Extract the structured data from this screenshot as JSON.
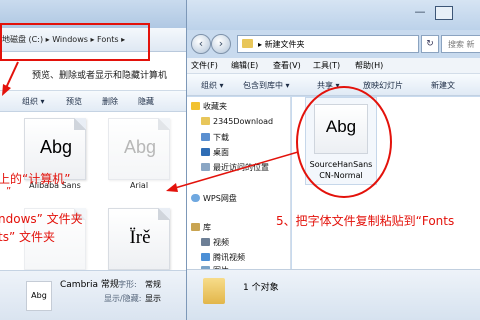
{
  "left_window": {
    "breadcrumb": [
      "地磁盘 (C:)",
      "Windows",
      "Fonts"
    ],
    "description": "预览、删除或者显示和隐藏计算机",
    "toolbar": [
      "组织 ▾",
      "预览",
      "删除",
      "隐藏"
    ],
    "fonts": [
      {
        "glyph": "Abg",
        "name": "Alibaba Sans"
      },
      {
        "glyph": "Abg",
        "name": "Arial"
      },
      {
        "glyph": "",
        "name": ""
      },
      {
        "glyph": "Ïrě",
        "name": ""
      }
    ],
    "status": {
      "glyph": "Abg",
      "name": "Cambria 常规",
      "label_style": "字形:",
      "style_value": "常规",
      "label_show": "显示/隐藏:",
      "show_value": "显示"
    }
  },
  "right_window": {
    "address": [
      "新建文件夹"
    ],
    "search_placeholder": "搜索 新",
    "menu": [
      "文件(F)",
      "编辑(E)",
      "查看(V)",
      "工具(T)",
      "帮助(H)"
    ],
    "toolbar": [
      "组织 ▾",
      "包含到库中 ▾",
      "共享 ▾",
      "放映幻灯片",
      "新建文"
    ],
    "nav": {
      "favorites_label": "收藏夹",
      "favorites": [
        "2345Download",
        "下载",
        "桌面",
        "最近访问的位置"
      ],
      "wps_label": "WPS网盘",
      "library_label": "库",
      "libraries": [
        "视频",
        "腾讯视频",
        "图片"
      ]
    },
    "file": {
      "glyph": "Abg",
      "name_line1": "SourceHanSans",
      "name_line2": "CN-Normal"
    },
    "status": "1 个对象"
  },
  "annotations": {
    "step5": "5、把字体文件复制粘贴到“Fonts",
    "line1": "上的“计算机”",
    "line2": "”",
    "line3": "ndows” 文件夹",
    "line4": "ts” 文件夹"
  },
  "colors": {
    "annotation_red": "#e3120b",
    "window_blue": "#c8daee"
  }
}
